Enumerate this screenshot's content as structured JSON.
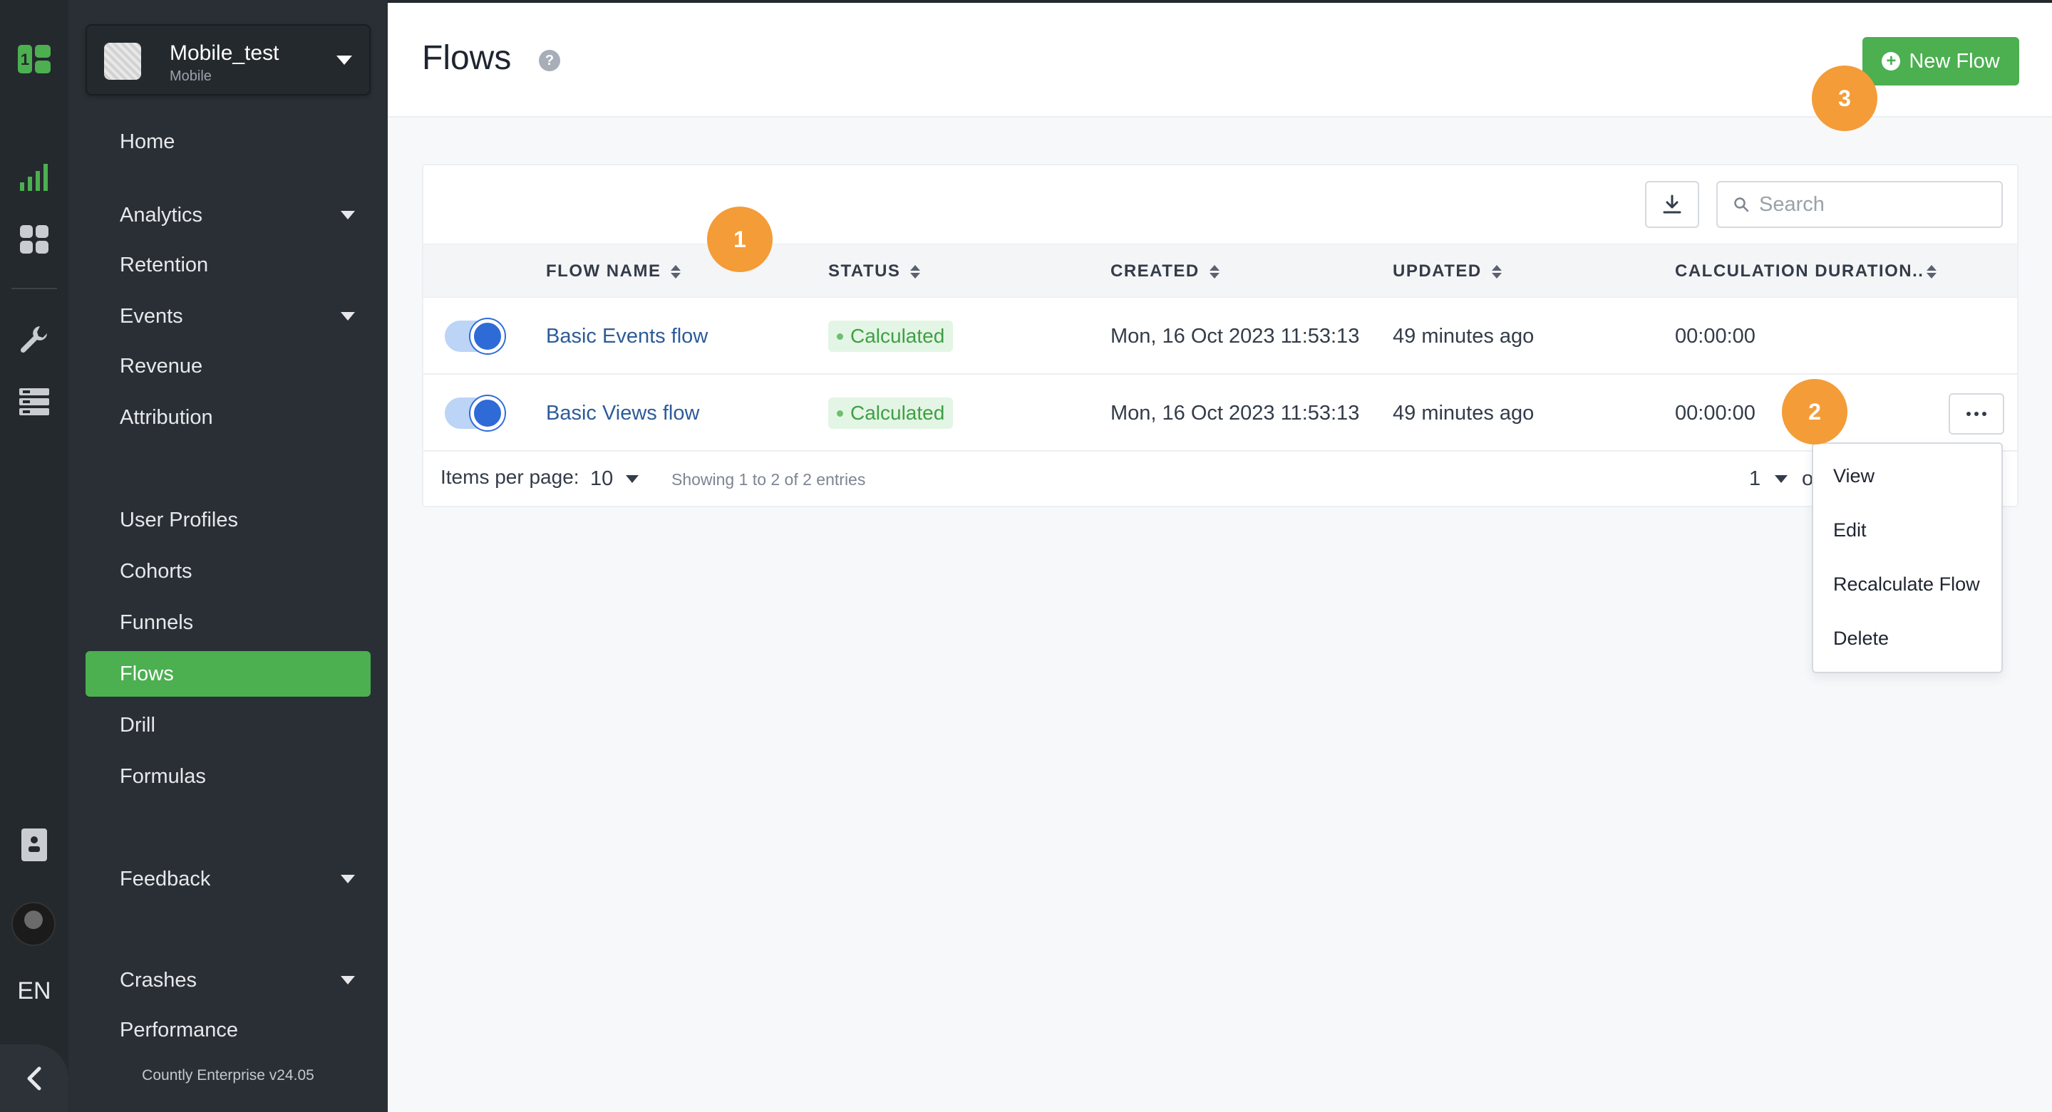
{
  "app": {
    "name": "Mobile_test",
    "type": "Mobile",
    "language": "EN",
    "version": "Countly Enterprise v24.05"
  },
  "rail_icons": [
    "countly-logo-icon",
    "dashboard-chart-icon",
    "widgets-grid-icon",
    "wrench-icon",
    "data-manager-icon",
    "document-icon",
    "user-avatar-icon",
    "collapse-chevron-icon"
  ],
  "sidebar": {
    "items": [
      {
        "label": "Home",
        "dropdown": false,
        "active": false
      },
      {
        "label": "Analytics",
        "dropdown": true,
        "active": false
      },
      {
        "label": "Retention",
        "dropdown": false,
        "active": false
      },
      {
        "label": "Events",
        "dropdown": true,
        "active": false
      },
      {
        "label": "Revenue",
        "dropdown": false,
        "active": false
      },
      {
        "label": "Attribution",
        "dropdown": false,
        "active": false
      },
      {
        "label": "User Profiles",
        "dropdown": false,
        "active": false
      },
      {
        "label": "Cohorts",
        "dropdown": false,
        "active": false
      },
      {
        "label": "Funnels",
        "dropdown": false,
        "active": false
      },
      {
        "label": "Flows",
        "dropdown": false,
        "active": true
      },
      {
        "label": "Drill",
        "dropdown": false,
        "active": false
      },
      {
        "label": "Formulas",
        "dropdown": false,
        "active": false
      },
      {
        "label": "Feedback",
        "dropdown": true,
        "active": false
      },
      {
        "label": "Crashes",
        "dropdown": true,
        "active": false
      },
      {
        "label": "Performance",
        "dropdown": false,
        "active": false
      }
    ]
  },
  "header": {
    "title": "Flows",
    "help_icon": "?",
    "new_flow_label": "New Flow"
  },
  "toolbar": {
    "search_placeholder": "Search",
    "export_icon": "download-icon"
  },
  "table": {
    "columns": [
      "FLOW NAME",
      "STATUS",
      "CREATED",
      "UPDATED",
      "CALCULATION DURATION.."
    ],
    "rows": [
      {
        "enabled": true,
        "name": "Basic Events flow",
        "status": "Calculated",
        "created": "Mon, 16 Oct 2023 11:53:13",
        "updated": "49 minutes ago",
        "duration": "00:00:00"
      },
      {
        "enabled": true,
        "name": "Basic Views flow",
        "status": "Calculated",
        "created": "Mon, 16 Oct 2023 11:53:13",
        "updated": "49 minutes ago",
        "duration": "00:00:00"
      }
    ]
  },
  "pagination": {
    "items_per_page_label": "Items per page:",
    "items_per_page": "10",
    "showing": "Showing 1 to 2 of 2 entries",
    "page": "1",
    "of_text": "o"
  },
  "row_menu": {
    "items": [
      "View",
      "Edit",
      "Recalculate Flow",
      "Delete"
    ]
  },
  "markers": [
    "1",
    "2",
    "3"
  ],
  "colors": {
    "accent": "#4caf50",
    "marker": "#f39c38",
    "link": "#2d5b9a",
    "sidebar_bg": "#2a2f35",
    "rail_bg": "#24292e"
  }
}
